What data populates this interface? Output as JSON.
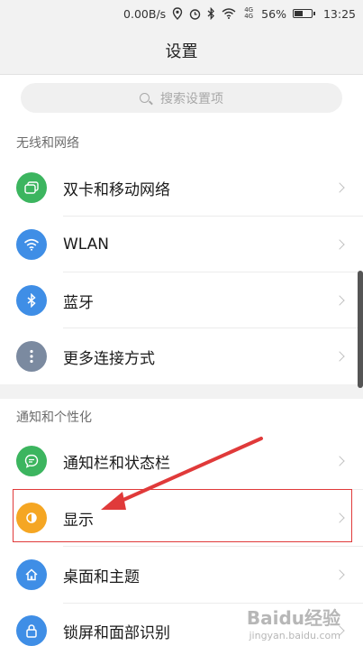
{
  "status_bar": {
    "speed": "0.00B/s",
    "signal": "4G 4G",
    "battery": "56%",
    "battery_level": 0.56,
    "time": "13:25",
    "icons": [
      "location-icon",
      "alarm-icon",
      "bluetooth-icon",
      "wifi-icon",
      "signal-icon",
      "battery-icon"
    ]
  },
  "header": {
    "title": "设置"
  },
  "search": {
    "placeholder": "搜索设置项"
  },
  "sections": [
    {
      "title": "无线和网络",
      "items": [
        {
          "label": "双卡和移动网络",
          "icon": "sim-card-icon",
          "color": "#3cb55f"
        },
        {
          "label": "WLAN",
          "icon": "wifi-icon",
          "color": "#3f8ee6"
        },
        {
          "label": "蓝牙",
          "icon": "bluetooth-icon",
          "color": "#3f8ee6"
        },
        {
          "label": "更多连接方式",
          "icon": "more-icon",
          "color": "#7b8aa0"
        }
      ]
    },
    {
      "title": "通知和个性化",
      "items": [
        {
          "label": "通知栏和状态栏",
          "icon": "notification-icon",
          "color": "#3cb55f"
        },
        {
          "label": "显示",
          "icon": "display-icon",
          "color": "#f5a623"
        },
        {
          "label": "桌面和主题",
          "icon": "home-icon",
          "color": "#3f8ee6"
        },
        {
          "label": "锁屏和面部识别",
          "icon": "lock-icon",
          "color": "#3f8ee6"
        }
      ]
    }
  ],
  "watermark": {
    "brand": "Baidu经验",
    "url": "jingyan.baidu.com"
  },
  "colors": {
    "highlight": "#e03a3a",
    "arrow": "#e03a3a"
  }
}
